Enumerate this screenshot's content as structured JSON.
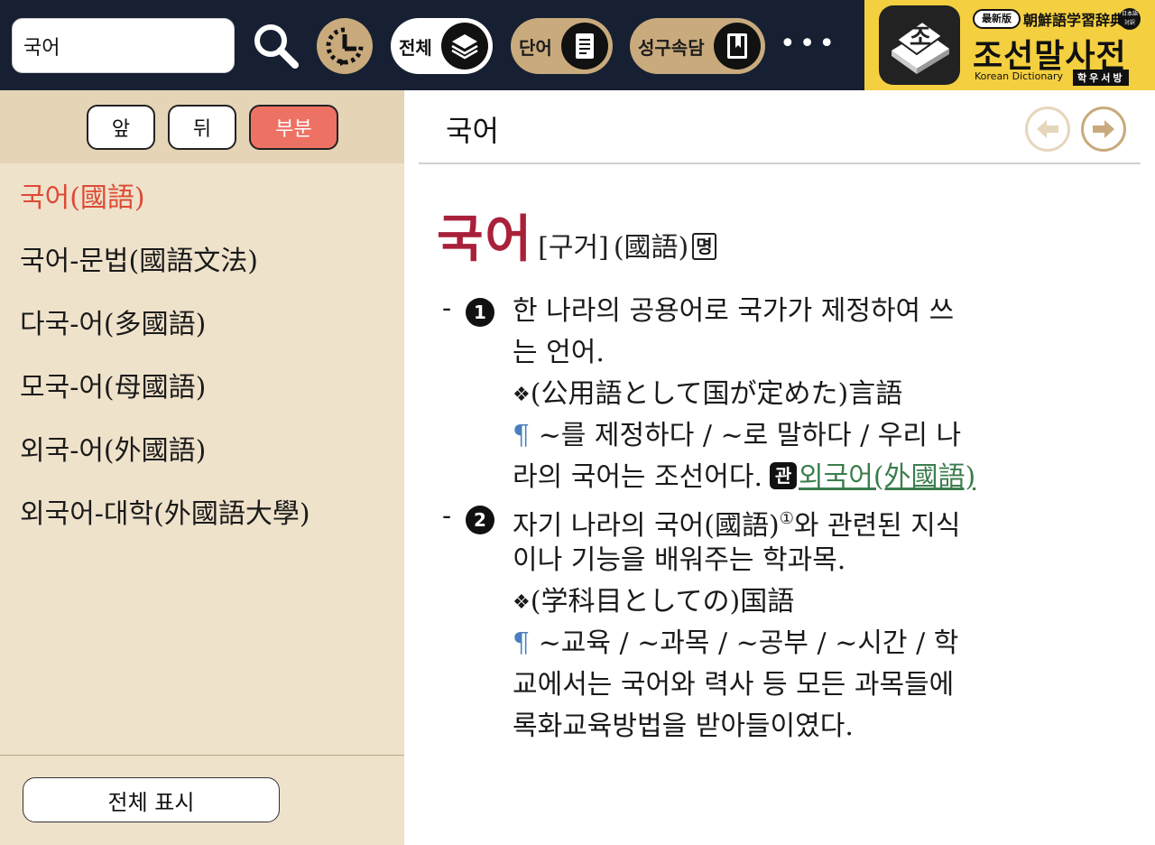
{
  "toolbar": {
    "search_value": "국어",
    "filter_all_label": "전체",
    "filter_word_label": "단어",
    "filter_idiom_label": "성구속담",
    "more_label": "•••"
  },
  "brand": {
    "edition": "最新版",
    "subtitle": "朝鮮語学習辞典",
    "badge": "日本語 対訳",
    "logo_char": "조",
    "title": "조선말사전",
    "english": "Korean Dictionary",
    "publisher": "학우서방"
  },
  "sidebar": {
    "prev_label": "앞",
    "next_label": "뒤",
    "partial_label": "부분",
    "items": [
      {
        "label": "국어(國語)"
      },
      {
        "label": "국어-문법(國語文法)"
      },
      {
        "label": "다국-어(多國語)"
      },
      {
        "label": "모국-어(母國語)"
      },
      {
        "label": "외국-어(外國語)"
      },
      {
        "label": "외국어-대학(外國語大學)"
      }
    ],
    "show_all_label": "전체 표시"
  },
  "entry": {
    "title": "국어",
    "headword": "국어",
    "pronunciation": "[구거]",
    "hanja": "(國語)",
    "pos": "명",
    "senses": [
      {
        "number": "1",
        "lines": [
          "한 나라의 공용어로 국가가 제정하여 쓰",
          "는 언어."
        ],
        "translation": "(公用語として国が定めた)言語",
        "example_lines": [
          "~를 제정하다 / ~로 말하다 / 우리 나",
          "라의 국어는 조선어다."
        ],
        "ref_badge": "관",
        "ref_link": "외국어(外國語)"
      },
      {
        "number": "2",
        "lines": [
          "자기 나라의 국어(國語)",
          "와 관련된 지식",
          "이나 기능을 배워주는 학과목."
        ],
        "sup": "①",
        "translation": "(学科目としての)国語",
        "example_lines": [
          "~교육 / ~과목 / ~공부 / ~시간 / 학",
          "교에서는 국어와 력사 등 모든 과목들에",
          "록화교육방법을 받아들이였다."
        ]
      }
    ]
  },
  "colors": {
    "topbar": "#162032",
    "accent_gold": "#c9aa7c",
    "brand_yellow": "#f4cf3f",
    "sidebar_bg": "#efe2cb",
    "active_item": "#dd4a36",
    "headword": "#a9203a",
    "link": "#3b7d4e",
    "pilcrow": "#4a7fbd"
  },
  "icons": [
    "search-icon",
    "history-icon",
    "layers-icon",
    "document-icon",
    "book-bookmark-icon",
    "back-arrow-icon",
    "forward-arrow-icon"
  ]
}
